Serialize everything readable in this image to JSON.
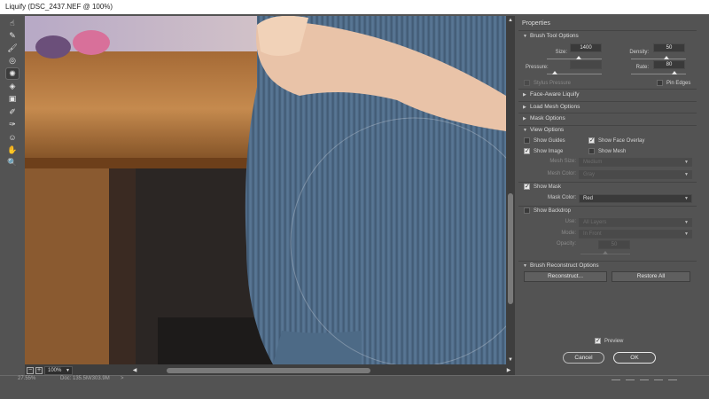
{
  "window": {
    "title": "Liquify (DSC_2437.NEF @ 100%)"
  },
  "toolbar": {
    "tools": [
      {
        "name": "forward-warp-tool-icon",
        "glyph": "☝"
      },
      {
        "name": "reconstruct-tool-icon",
        "glyph": "✎"
      },
      {
        "name": "smooth-tool-icon",
        "glyph": "🖌"
      },
      {
        "name": "twirl-tool-icon",
        "glyph": "◎"
      },
      {
        "name": "pucker-tool-icon",
        "glyph": "✺"
      },
      {
        "name": "bloat-tool-icon",
        "glyph": "◈"
      },
      {
        "name": "push-left-tool-icon",
        "glyph": "▣"
      },
      {
        "name": "freeze-mask-tool-icon",
        "glyph": "✐"
      },
      {
        "name": "thaw-mask-tool-icon",
        "glyph": "✑"
      },
      {
        "name": "face-tool-icon",
        "glyph": "☺"
      },
      {
        "name": "hand-tool-icon",
        "glyph": "✋"
      },
      {
        "name": "zoom-tool-icon",
        "glyph": "🔍"
      }
    ]
  },
  "canvas": {
    "zoom": "100%",
    "zoom_out": "−",
    "zoom_in": "+"
  },
  "properties": {
    "title": "Properties",
    "brush_tool_options": {
      "header": "Brush Tool Options",
      "size_label": "Size:",
      "size": "1400",
      "density_label": "Density:",
      "density": "50",
      "pressure_label": "Pressure:",
      "pressure": "",
      "rate_label": "Rate:",
      "rate": "80",
      "stylus_pressure": "Stylus Pressure",
      "pin_edges": "Pin Edges"
    },
    "face_aware": "Face-Aware Liquify",
    "load_mesh": "Load Mesh Options",
    "mask_options": "Mask Options",
    "view_options": {
      "header": "View Options",
      "show_guides": "Show Guides",
      "show_face_overlay": "Show Face Overlay",
      "show_image": "Show Image",
      "show_mesh": "Show Mesh",
      "mesh_size_label": "Mesh Size:",
      "mesh_size": "Medium",
      "mesh_color_label": "Mesh Color:",
      "mesh_color": "Gray",
      "show_mask": "Show Mask",
      "mask_color_label": "Mask Color:",
      "mask_color": "Red",
      "show_backdrop": "Show Backdrop",
      "use_label": "Use:",
      "use": "All Layers",
      "mode_label": "Mode:",
      "mode": "In Front",
      "opacity_label": "Opacity:",
      "opacity": "50"
    },
    "brush_reconstruct": {
      "header": "Brush Reconstruct Options",
      "reconstruct": "Reconstruct...",
      "restore_all": "Restore All"
    },
    "preview": "Preview",
    "cancel": "Cancel",
    "ok": "OK"
  },
  "status": {
    "zoom": "27.55%",
    "doc": "Doc: 135.5M/303.9M",
    "arrow": ">"
  }
}
